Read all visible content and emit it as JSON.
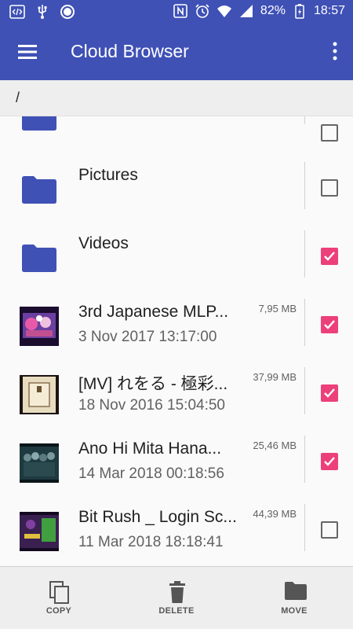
{
  "status_bar": {
    "battery_percent": "82%",
    "time": "18:57",
    "icons": [
      "code-icon",
      "usb-icon",
      "record-icon",
      "nfc-icon",
      "alarm-icon",
      "wifi-icon",
      "signal-icon",
      "battery-icon"
    ]
  },
  "app_bar": {
    "title": "Cloud Browser",
    "background_color": "#3f51b5"
  },
  "breadcrumb": {
    "path": "/"
  },
  "list": {
    "items": [
      {
        "type": "folder",
        "name": "",
        "date": "",
        "size": "",
        "checked": false
      },
      {
        "type": "folder",
        "name": "Pictures",
        "date": "",
        "size": "",
        "checked": false
      },
      {
        "type": "folder",
        "name": "Videos",
        "date": "",
        "size": "",
        "checked": true
      },
      {
        "type": "file",
        "name": "3rd Japanese MLP...",
        "date": "3 Nov 2017 13:17:00",
        "size": "7,95 MB",
        "checked": true
      },
      {
        "type": "file",
        "name": "[MV] れをる - 極彩...",
        "date": "18 Nov 2016 15:04:50",
        "size": "37,99 MB",
        "checked": true
      },
      {
        "type": "file",
        "name": "Ano Hi Mita Hana...",
        "date": "14 Mar 2018 00:18:56",
        "size": "25,46 MB",
        "checked": true
      },
      {
        "type": "file",
        "name": "Bit Rush _ Login Sc...",
        "date": "11 Mar 2018 18:18:41",
        "size": "44,39 MB",
        "checked": false
      }
    ]
  },
  "bottom_bar": {
    "copy_label": "COPY",
    "delete_label": "DELETE",
    "move_label": "MOVE"
  },
  "colors": {
    "primary": "#3f51b5",
    "folder": "#3f51b5",
    "checkbox_checked": "#ec407a"
  }
}
